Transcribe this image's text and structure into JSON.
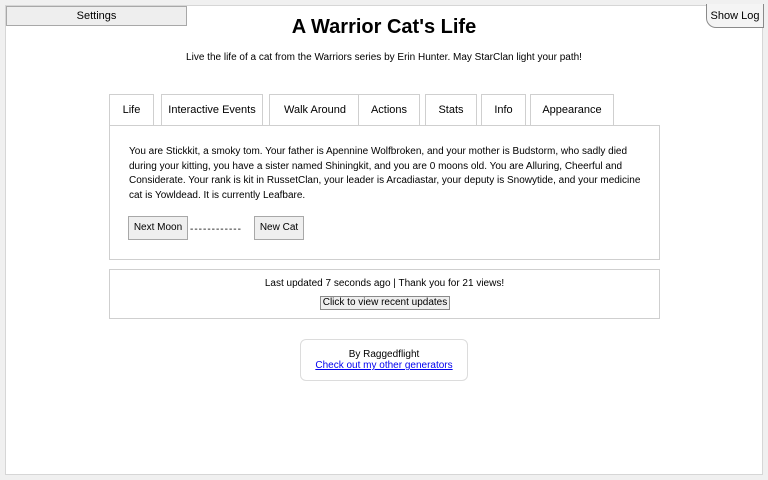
{
  "header": {
    "settings_label": "Settings",
    "show_log_label": "Show Log",
    "title": "A Warrior Cat's Life",
    "subtitle": "Live the life of a cat from the Warriors series by Erin Hunter. May StarClan light your path!"
  },
  "tabs": [
    {
      "label": "Life",
      "active": true
    },
    {
      "label": "Interactive Events"
    },
    {
      "label": "Walk Around"
    },
    {
      "label": "Actions"
    },
    {
      "label": "Stats"
    },
    {
      "label": "Info"
    },
    {
      "label": "Appearance"
    }
  ],
  "life_panel": {
    "story": "You are Stickkit, a smoky tom. Your father is Apennine Wolfbroken, and your mother is Budstorm, who sadly died during your kitting, you have a sister named Shiningkit, and you are 0 moons old. You are Alluring, Cheerful and Considerate. Your rank is kit in RussetClan, your leader is Arcadiastar, your deputy is Snowytide, and your medicine cat is Yowldead. It is currently Leafbare.",
    "next_moon_label": "Next Moon",
    "separator": "------------",
    "new_cat_label": "New Cat"
  },
  "updates": {
    "status": "Last updated 7 seconds ago | Thank you for 21 views!",
    "recent_updates_label": "Click to view recent updates"
  },
  "footer": {
    "author": "By Raggedflight",
    "generators_link": "Check out my other generators"
  }
}
